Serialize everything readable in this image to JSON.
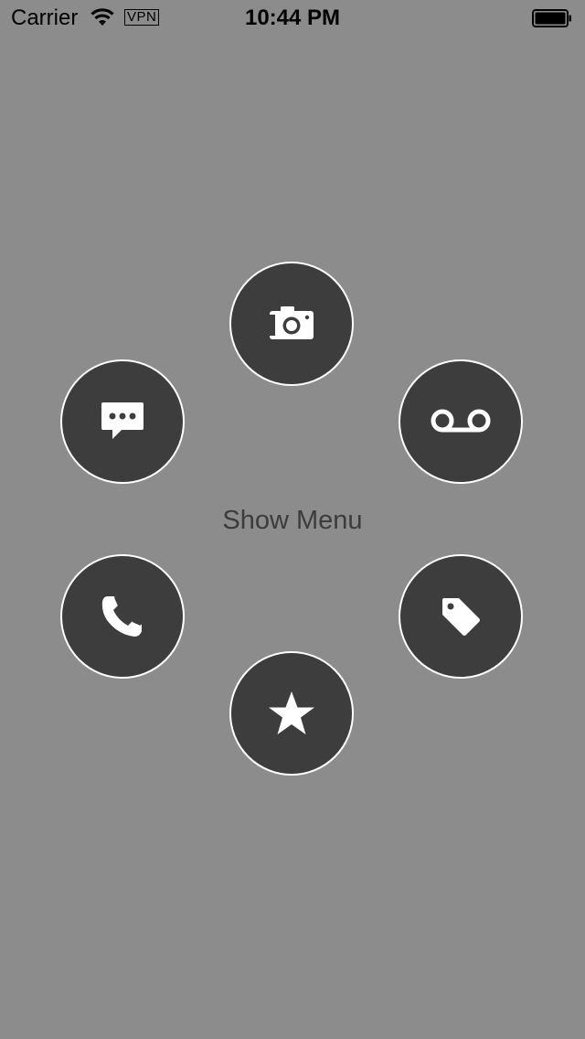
{
  "status_bar": {
    "carrier": "Carrier",
    "vpn_label": "VPN",
    "time": "10:44 PM",
    "wifi_icon": "wifi-icon",
    "battery_icon": "battery-icon"
  },
  "main": {
    "show_menu_label": "Show Menu",
    "background_color": "#8c8c8c",
    "button_color": "#3d3d3d",
    "button_border_color": "#ffffff"
  },
  "menu_items": [
    {
      "icon": "camera-icon"
    },
    {
      "icon": "voicemail-icon"
    },
    {
      "icon": "tag-icon"
    },
    {
      "icon": "star-icon"
    },
    {
      "icon": "phone-icon"
    },
    {
      "icon": "chat-bubble-icon"
    }
  ]
}
